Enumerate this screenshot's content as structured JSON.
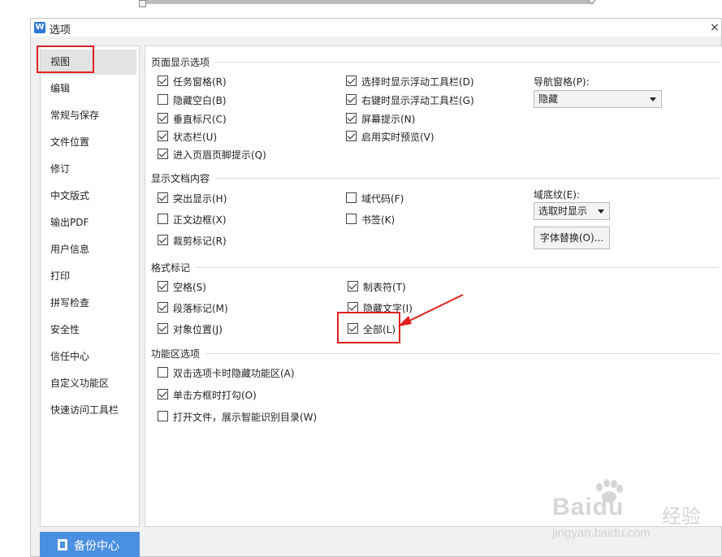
{
  "window": {
    "title": "选项",
    "app_icon_letter": "W",
    "close_symbol": "×"
  },
  "nav": {
    "items": [
      {
        "label": "视图",
        "selected": true
      },
      {
        "label": "编辑"
      },
      {
        "label": "常规与保存"
      },
      {
        "label": "文件位置"
      },
      {
        "label": "修订"
      },
      {
        "label": "中文版式"
      },
      {
        "label": "输出PDF"
      },
      {
        "label": "用户信息"
      },
      {
        "label": "打印"
      },
      {
        "label": "拼写检查"
      },
      {
        "label": "安全性"
      },
      {
        "label": "信任中心"
      },
      {
        "label": "自定义功能区"
      },
      {
        "label": "快速访问工具栏"
      }
    ],
    "backup_label": "备份中心"
  },
  "sections": {
    "page_display": {
      "title": "页面显示选项",
      "options": [
        {
          "label": "任务窗格(R)",
          "checked": true
        },
        {
          "label": "隐藏空白(B)",
          "checked": false
        },
        {
          "label": "垂直标尺(C)",
          "checked": true
        },
        {
          "label": "状态栏(U)",
          "checked": true
        },
        {
          "label": "进入页眉页脚提示(Q)",
          "checked": true
        },
        {
          "label": "选择时显示浮动工具栏(D)",
          "checked": true
        },
        {
          "label": "右键时显示浮动工具栏(G)",
          "checked": true
        },
        {
          "label": "屏幕提示(N)",
          "checked": true
        },
        {
          "label": "启用实时预览(V)",
          "checked": true
        }
      ],
      "nav_pane_label": "导航窗格(P):",
      "nav_pane_value": "隐藏"
    },
    "doc_content": {
      "title": "显示文档内容",
      "options": [
        {
          "label": "突出显示(H)",
          "checked": true
        },
        {
          "label": "正文边框(X)",
          "checked": false
        },
        {
          "label": "裁剪标记(R)",
          "checked": true
        },
        {
          "label": "域代码(F)",
          "checked": false
        },
        {
          "label": "书签(K)",
          "checked": false
        }
      ],
      "field_shading_label": "域底纹(E):",
      "field_shading_value": "选取时显示",
      "font_replace_button": "字体替换(O)..."
    },
    "format_marks": {
      "title": "格式标记",
      "options": [
        {
          "label": "空格(S)",
          "checked": true
        },
        {
          "label": "段落标记(M)",
          "checked": true
        },
        {
          "label": "对象位置(J)",
          "checked": true
        },
        {
          "label": "制表符(T)",
          "checked": true
        },
        {
          "label": "隐藏文字(I)",
          "checked": true
        },
        {
          "label": "全部(L)",
          "checked": true
        }
      ]
    },
    "ribbon": {
      "title": "功能区选项",
      "options": [
        {
          "label": "双击选项卡时隐藏功能区(A)",
          "checked": false
        },
        {
          "label": "单击方框时打勾(O)",
          "checked": true
        },
        {
          "label": "打开文件，展示智能识别目录(W)",
          "checked": false
        }
      ]
    }
  },
  "colors": {
    "highlight": "#e02020",
    "backup_bg": "#4a8fe0",
    "selected_nav": "#e3e3e3"
  },
  "watermark": {
    "brand": "Baidu",
    "sub": "经验",
    "url": "jingyan.baidu.com"
  }
}
